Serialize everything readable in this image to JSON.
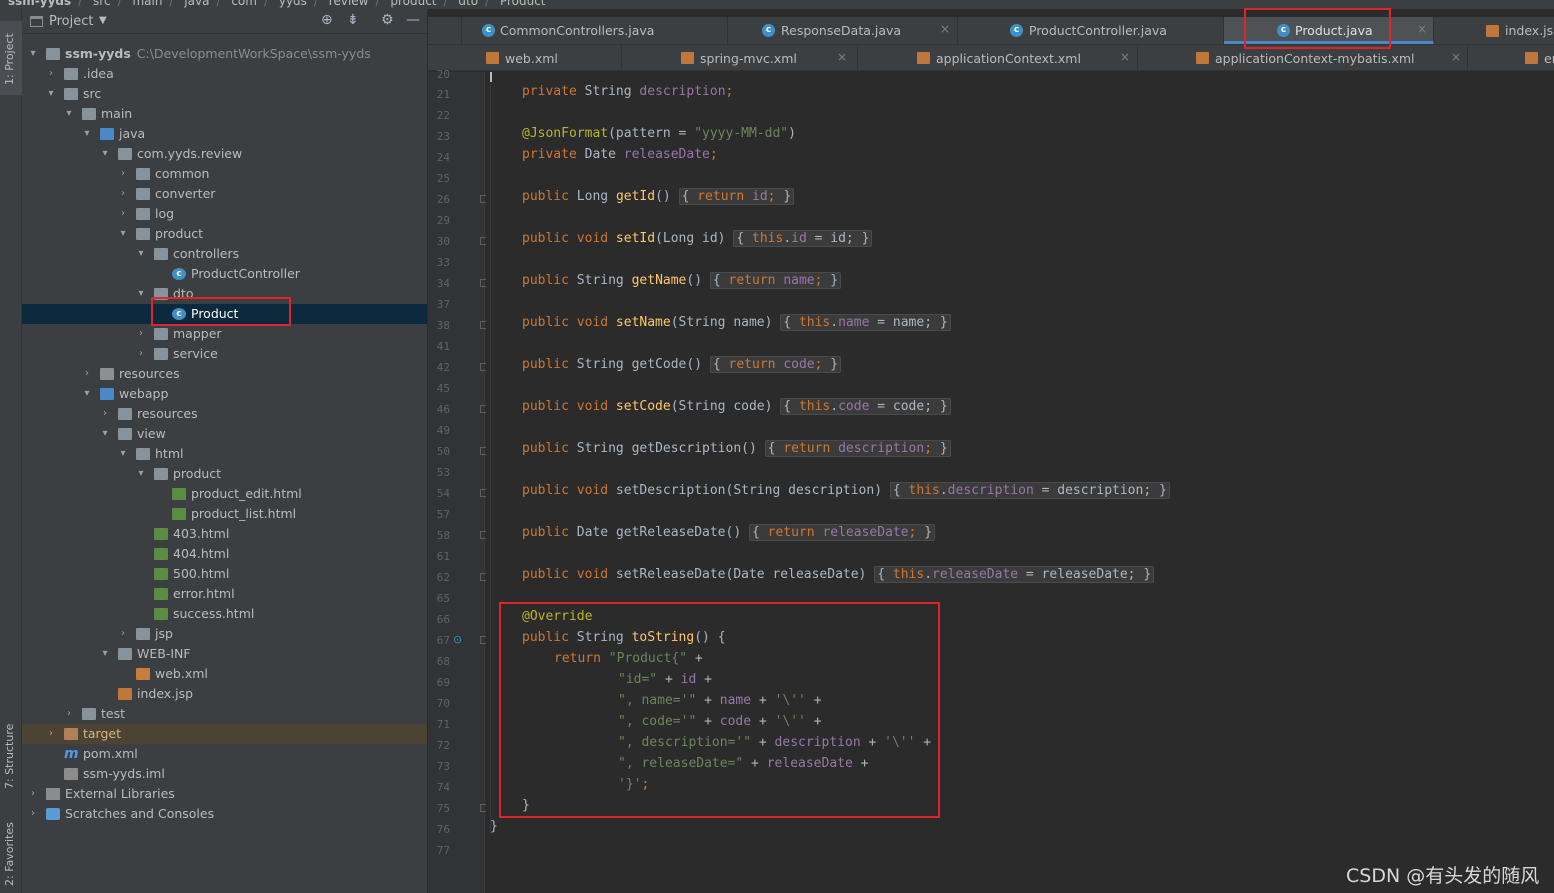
{
  "breadcrumb": [
    "ssm-yyds",
    "src",
    "main",
    "java",
    "com",
    "yyds",
    "review",
    "product",
    "dto",
    "Product"
  ],
  "strip": {
    "project": "1: Project",
    "structure": "7: Structure",
    "favorites": "2: Favorites"
  },
  "panel": {
    "title": "Project",
    "dropdown_icon": "chevron-down",
    "tools": [
      "locate-icon",
      "collapse-icon",
      "gear-icon",
      "minimize-icon"
    ]
  },
  "tree": {
    "root_label": "ssm-yyds",
    "root_path": "C:\\DevelopmentWorkSpace\\ssm-yyds",
    "items": [
      {
        "label": ".idea",
        "icon": "folder"
      },
      {
        "label": "src",
        "icon": "folder"
      },
      {
        "label": "main",
        "icon": "folder"
      },
      {
        "label": "java",
        "icon": "source-folder"
      },
      {
        "label": "com.yyds.review",
        "icon": "package"
      },
      {
        "label": "common",
        "icon": "package"
      },
      {
        "label": "converter",
        "icon": "package"
      },
      {
        "label": "log",
        "icon": "package"
      },
      {
        "label": "product",
        "icon": "package"
      },
      {
        "label": "controllers",
        "icon": "package"
      },
      {
        "label": "ProductController",
        "icon": "class"
      },
      {
        "label": "dto",
        "icon": "package"
      },
      {
        "label": "Product",
        "icon": "class"
      },
      {
        "label": "mapper",
        "icon": "package"
      },
      {
        "label": "service",
        "icon": "package"
      },
      {
        "label": "resources",
        "icon": "resources-folder"
      },
      {
        "label": "webapp",
        "icon": "web-folder"
      },
      {
        "label": "resources",
        "icon": "folder"
      },
      {
        "label": "view",
        "icon": "folder"
      },
      {
        "label": "html",
        "icon": "folder"
      },
      {
        "label": "product",
        "icon": "folder"
      },
      {
        "label": "product_edit.html",
        "icon": "html"
      },
      {
        "label": "product_list.html",
        "icon": "html"
      },
      {
        "label": "403.html",
        "icon": "html"
      },
      {
        "label": "404.html",
        "icon": "html"
      },
      {
        "label": "500.html",
        "icon": "html"
      },
      {
        "label": "error.html",
        "icon": "html"
      },
      {
        "label": "success.html",
        "icon": "html"
      },
      {
        "label": "jsp",
        "icon": "folder"
      },
      {
        "label": "WEB-INF",
        "icon": "folder"
      },
      {
        "label": "web.xml",
        "icon": "xml"
      },
      {
        "label": "index.jsp",
        "icon": "jsp"
      },
      {
        "label": "test",
        "icon": "folder"
      },
      {
        "label": "target",
        "icon": "target-folder"
      },
      {
        "label": "pom.xml",
        "icon": "maven"
      },
      {
        "label": "ssm-yyds.iml",
        "icon": "iml"
      },
      {
        "label": "External Libraries",
        "icon": "libraries"
      },
      {
        "label": "Scratches and Consoles",
        "icon": "scratches"
      }
    ]
  },
  "tabs_row1": [
    {
      "label": "CommonControllers.java",
      "icon": "class"
    },
    {
      "label": "ResponseData.java",
      "icon": "class"
    },
    {
      "label": "ProductController.java",
      "icon": "class"
    },
    {
      "label": "Product.java",
      "icon": "class",
      "active": true
    },
    {
      "label": "index.jsp",
      "icon": "jsp"
    }
  ],
  "tabs_row2": [
    {
      "label": "web.xml",
      "icon": "xml"
    },
    {
      "label": "spring-mvc.xml",
      "icon": "xml"
    },
    {
      "label": "applicationContext.xml",
      "icon": "xml"
    },
    {
      "label": "applicationContext-mybatis.xml",
      "icon": "xml"
    },
    {
      "label": "er",
      "icon": "xml"
    }
  ],
  "close_glyph": "×",
  "editor": {
    "line_numbers": [
      "20",
      "21",
      "22",
      "23",
      "24",
      "25",
      "26",
      "29",
      "30",
      "33",
      "34",
      "37",
      "38",
      "41",
      "42",
      "45",
      "46",
      "49",
      "50",
      "53",
      "54",
      "57",
      "58",
      "61",
      "62",
      "65",
      "66",
      "67",
      "68",
      "69",
      "70",
      "71",
      "72",
      "73",
      "74",
      "75",
      "76",
      "77"
    ],
    "lines": {
      "l21": {
        "kw": "private ",
        "type": "String ",
        "field": "description",
        "semi": ";"
      },
      "l23": {
        "ann": "@JsonFormat",
        "open": "(pattern = ",
        "str": "\"yyyy-MM-dd\"",
        "close": ")"
      },
      "l24": {
        "kw": "private ",
        "type": "Date ",
        "field": "releaseDate",
        "semi": ";"
      },
      "l26": {
        "kw": "public ",
        "type": "Long ",
        "name": "getId",
        "args": "()",
        "body_kw": "return ",
        "body_field": "id",
        "body_rest": ";"
      },
      "l30": {
        "kw": "public void ",
        "name": "setId",
        "args": "(Long id)",
        "body_kw": "this",
        "dot": ".",
        "body_field": "id",
        "body_rest": " = id;"
      },
      "l34": {
        "kw": "public ",
        "type": "String ",
        "name": "getName",
        "args": "()",
        "body_kw": "return ",
        "body_field": "name",
        "body_rest": ";"
      },
      "l38": {
        "kw": "public void ",
        "name": "setName",
        "args": "(String name)",
        "body_kw": "this",
        "dot": ".",
        "body_field": "name",
        "body_rest": " = name;"
      },
      "l42": {
        "kw": "public ",
        "type": "String ",
        "name": "getCode",
        "args": "()",
        "body_kw": "return ",
        "body_field": "code",
        "body_rest": ";"
      },
      "l46": {
        "kw": "public void ",
        "name": "setCode",
        "args": "(String code)",
        "body_kw": "this",
        "dot": ".",
        "body_field": "code",
        "body_rest": " = code;"
      },
      "l50": {
        "kw": "public ",
        "type": "String ",
        "name": "getDescription",
        "args": "()",
        "body_kw": "return ",
        "body_field": "description",
        "body_rest": ";"
      },
      "l54": {
        "kw": "public void ",
        "name": "setDescription",
        "args": "(String description)",
        "body_kw": "this",
        "dot": ".",
        "body_field": "description",
        "body_rest": " = description;"
      },
      "l58": {
        "kw": "public ",
        "type": "Date ",
        "name": "getReleaseDate",
        "args": "()",
        "body_kw": "return ",
        "body_field": "releaseDate",
        "body_rest": ";"
      },
      "l62": {
        "kw": "public void ",
        "name": "setReleaseDate",
        "args": "(Date releaseDate)",
        "body_kw": "this",
        "dot": ".",
        "body_field": "releaseDate",
        "body_rest": " = releaseDate;"
      },
      "l66": {
        "ann": "@Override"
      },
      "l67": {
        "kw": "public ",
        "type": "String ",
        "name": "toString",
        "rest": "() {"
      },
      "l68": {
        "kw": "return ",
        "str": "\"Product{\"",
        "rest": " +"
      },
      "l69": {
        "str": "\"id=\"",
        "op": " + ",
        "field": "id",
        "rest": " +"
      },
      "l70": {
        "str": "\", name='\"",
        "op": " + ",
        "field": "name",
        "op2": " + ",
        "str2": "'\\''",
        "rest": " +"
      },
      "l71": {
        "str": "\", code='\"",
        "op": " + ",
        "field": "code",
        "op2": " + ",
        "str2": "'\\''",
        "rest": " +"
      },
      "l72": {
        "str": "\", description='\"",
        "op": " + ",
        "field": "description",
        "op2": " + ",
        "str2": "'\\''",
        "rest": " +"
      },
      "l73": {
        "str": "\", releaseDate=\"",
        "op": " + ",
        "field": "releaseDate",
        "rest": " +"
      },
      "l74": {
        "str": "'}'",
        "rest": ";"
      },
      "l75": {
        "rest": "}"
      },
      "l76": {
        "rest": "}"
      }
    }
  },
  "brace_open": "{",
  "brace_close": "}",
  "watermark": "CSDN @有头发的随风",
  "highlight_color": "#e0242b",
  "accent": "#4a88c7"
}
